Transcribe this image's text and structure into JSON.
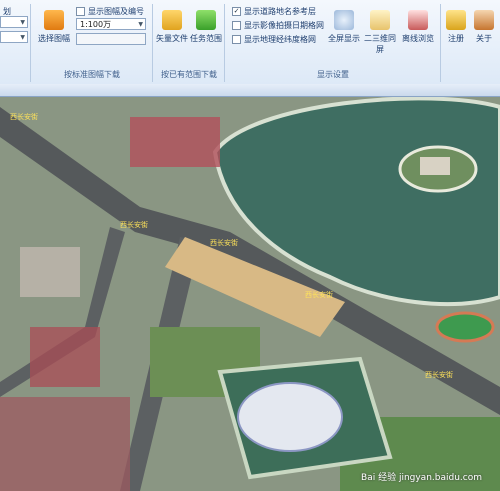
{
  "ribbon": {
    "left_tab_text": "划",
    "groups": {
      "standard_download": {
        "label": "按标准图幅下载",
        "select_sheet_label": "选择图幅",
        "show_sheet_number": "显示图幅及编号",
        "scale_value": "1:100万"
      },
      "existing_download": {
        "label": "按已有范围下载",
        "vector_file_label": "矢量文件",
        "task_range_label": "任务范围"
      },
      "display_settings": {
        "label": "显示设置",
        "check1": "显示道路地名参考层",
        "check2": "显示影像拍摄日期格网",
        "check3": "显示地理经纬度格网",
        "fullscreen_label": "全屏显示",
        "split_label": "二三维同屏",
        "offline_label": "离线浏览"
      },
      "other": {
        "register_label": "注册",
        "about_label": "关于"
      }
    }
  },
  "map": {
    "road_labels": [
      "西长安街",
      "西长安街",
      "西长安街",
      "西长安街",
      "西长安街"
    ],
    "watermark": "Bai 经验 jingyan.baidu.com"
  },
  "colors": {
    "accent": "#3b78c2",
    "lake": "#3f6e62",
    "road": "#555a5c"
  }
}
